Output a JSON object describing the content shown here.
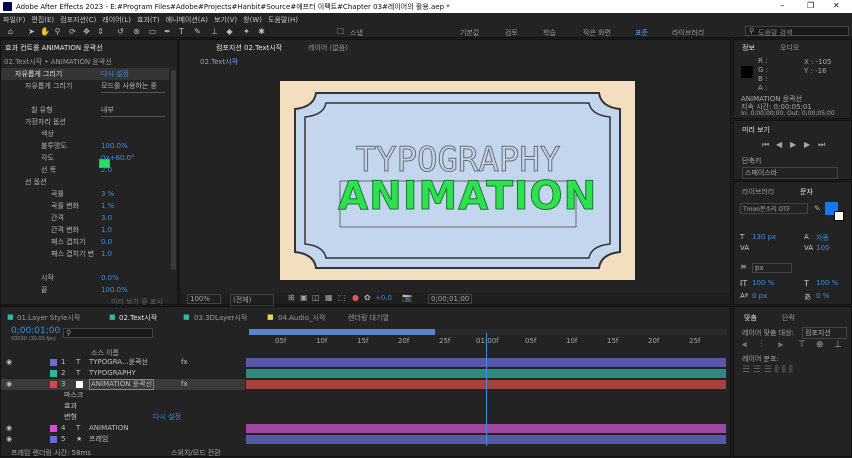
{
  "app": {
    "title": "Adobe After Effects 2023 - E:#Program Files#Adobe#Projects#Hanbit#Source#에프터 이펙트#Chapter 03#레이어의 활용.aep *",
    "min": "–",
    "max": "❐",
    "close": "✕"
  },
  "menu": [
    "파일(F)",
    "편집(E)",
    "컴포지션(C)",
    "레이어(L)",
    "효과(T)",
    "애니메이션(A)",
    "보기(V)",
    "창(W)",
    "도움말(H)"
  ],
  "toolbar": {
    "snap": "스냅",
    "workspaces": [
      "기본값",
      "검토",
      "학습",
      "작은 화면",
      "표준",
      "라이브러리"
    ],
    "search": "도움말 검색"
  },
  "effects": {
    "tab": "효과 컨트롤 ANIMATION 윤곽선",
    "sub": "02.Text시작 • ANIMATION 윤곽선",
    "rows": [
      {
        "l": "자유롭게 그리기",
        "v": "다시 설정"
      },
      {
        "l": "자유롭게 그리기",
        "v": "모드를 사용하는 중"
      },
      {
        "l": "칠 유형",
        "v": "내부"
      },
      {
        "l": "가장자리 옵션",
        "v": ""
      },
      {
        "l": "색상",
        "v": ""
      },
      {
        "l": "불투명도",
        "v": "100.0%"
      },
      {
        "l": "각도",
        "v": "0x+60.0°"
      },
      {
        "l": "선 폭",
        "v": "2.0"
      },
      {
        "l": "선 옵션",
        "v": ""
      },
      {
        "l": "곡률",
        "v": "3 %"
      },
      {
        "l": "곡률 변화",
        "v": "1 %"
      },
      {
        "l": "간격",
        "v": "3.0"
      },
      {
        "l": "간격 변화",
        "v": "1.0"
      },
      {
        "l": "패스 겹치기",
        "v": "0.0"
      },
      {
        "l": "패스 겹치기 변",
        "v": "1.0"
      },
      {
        "l": "시작",
        "v": "0.0%"
      },
      {
        "l": "끝",
        "v": "100.0%"
      },
      {
        "l": "미리 보기 중 표시",
        "v": ""
      }
    ]
  },
  "comp": {
    "tab": "컴포지션 02.Text시작",
    "tab2": "레이어 (없음)",
    "crumb": "02.Text시작",
    "title": "ANIMATION",
    "zoom": "100%",
    "quality": "(전체)",
    "time": "0;00;01;00",
    "exposure": "+0.0"
  },
  "info": {
    "tab": "정보",
    "tab2": "오디오",
    "r": "R :",
    "g": "G :",
    "b": "B :",
    "a": "A :",
    "x": "X : -105",
    "y": "Y : -16",
    "layer": "ANIMATION 윤곽선",
    "time": "지속 시간: 0;00:05;01",
    "inout": "In: 0;00;00;00, Out: 0;00;05;00"
  },
  "preview": {
    "tab": "미리 보기",
    "shortcut": "단축키",
    "space": "스페이스바"
  },
  "char": {
    "tab": "라이브러리",
    "tab2": "문자",
    "font": "Tmon몬소리 OTF",
    "style": "",
    "size": "130 px",
    "tracking": "자동",
    "kern": "100",
    "leading": "px",
    "vscale": "100 %",
    "hscale": "100 %",
    "baseline": "0 px",
    "tsume": "0 %"
  },
  "align": {
    "tab": "맞춤",
    "tab2": "단락",
    "alignto": "레이어 맞춤 대상:",
    "target": "컴포지션",
    "distribute": "레이어 분포:"
  },
  "timeline": {
    "tabs": [
      "01.Layer Style시작",
      "02.Text시작",
      "03.3DLayer시작",
      "04.Audio_시작",
      "렌더링 대기열"
    ],
    "time": "0;00:01;00",
    "fps": "00030 (30.00 fps)",
    "search": "",
    "col": "소스 이름",
    "ticks": [
      "05f",
      "10f",
      "15f",
      "20f",
      "25f",
      "01:00f",
      "05f",
      "10f",
      "15f",
      "20f",
      "25f"
    ],
    "layers": [
      {
        "n": "1",
        "name": "TYPOGRA...윤곽선",
        "t": "fx"
      },
      {
        "n": "2",
        "name": "TYPOGRAPHY",
        "t": "T"
      },
      {
        "n": "3",
        "name": "ANIMATION 윤곽선",
        "t": "fx"
      },
      {
        "n": "",
        "name": "마스크",
        "t": ""
      },
      {
        "n": "",
        "name": "효과",
        "t": ""
      },
      {
        "n": "",
        "name": "변형",
        "t": "다시 설정"
      },
      {
        "n": "4",
        "name": "ANIMATION",
        "t": "T"
      },
      {
        "n": "5",
        "name": "프레임",
        "t": ""
      }
    ],
    "footer": "프레임 렌더링 시간: 58ms",
    "toggle": "스위치/모드 전환"
  },
  "colors": {
    "accent": "#2d8ceb",
    "orange": "#e0c48f",
    "selected": "#3a3a3a"
  }
}
